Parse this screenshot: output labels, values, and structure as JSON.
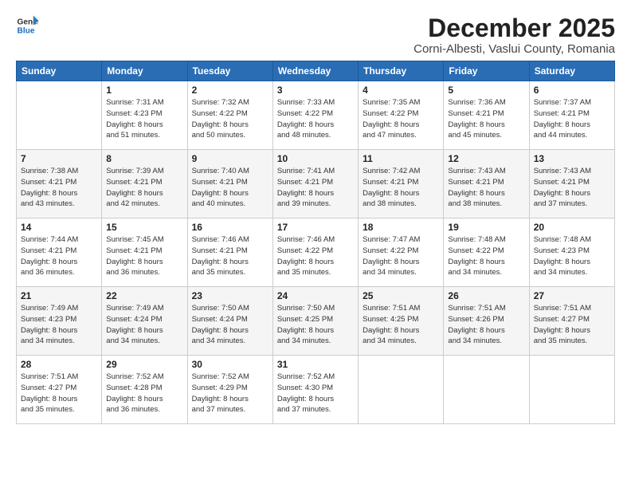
{
  "logo": {
    "line1": "General",
    "line2": "Blue"
  },
  "title": "December 2025",
  "location": "Corni-Albesti, Vaslui County, Romania",
  "weekdays": [
    "Sunday",
    "Monday",
    "Tuesday",
    "Wednesday",
    "Thursday",
    "Friday",
    "Saturday"
  ],
  "weeks": [
    [
      {
        "day": "",
        "info": ""
      },
      {
        "day": "1",
        "info": "Sunrise: 7:31 AM\nSunset: 4:23 PM\nDaylight: 8 hours\nand 51 minutes."
      },
      {
        "day": "2",
        "info": "Sunrise: 7:32 AM\nSunset: 4:22 PM\nDaylight: 8 hours\nand 50 minutes."
      },
      {
        "day": "3",
        "info": "Sunrise: 7:33 AM\nSunset: 4:22 PM\nDaylight: 8 hours\nand 48 minutes."
      },
      {
        "day": "4",
        "info": "Sunrise: 7:35 AM\nSunset: 4:22 PM\nDaylight: 8 hours\nand 47 minutes."
      },
      {
        "day": "5",
        "info": "Sunrise: 7:36 AM\nSunset: 4:21 PM\nDaylight: 8 hours\nand 45 minutes."
      },
      {
        "day": "6",
        "info": "Sunrise: 7:37 AM\nSunset: 4:21 PM\nDaylight: 8 hours\nand 44 minutes."
      }
    ],
    [
      {
        "day": "7",
        "info": "Sunrise: 7:38 AM\nSunset: 4:21 PM\nDaylight: 8 hours\nand 43 minutes."
      },
      {
        "day": "8",
        "info": "Sunrise: 7:39 AM\nSunset: 4:21 PM\nDaylight: 8 hours\nand 42 minutes."
      },
      {
        "day": "9",
        "info": "Sunrise: 7:40 AM\nSunset: 4:21 PM\nDaylight: 8 hours\nand 40 minutes."
      },
      {
        "day": "10",
        "info": "Sunrise: 7:41 AM\nSunset: 4:21 PM\nDaylight: 8 hours\nand 39 minutes."
      },
      {
        "day": "11",
        "info": "Sunrise: 7:42 AM\nSunset: 4:21 PM\nDaylight: 8 hours\nand 38 minutes."
      },
      {
        "day": "12",
        "info": "Sunrise: 7:43 AM\nSunset: 4:21 PM\nDaylight: 8 hours\nand 38 minutes."
      },
      {
        "day": "13",
        "info": "Sunrise: 7:43 AM\nSunset: 4:21 PM\nDaylight: 8 hours\nand 37 minutes."
      }
    ],
    [
      {
        "day": "14",
        "info": "Sunrise: 7:44 AM\nSunset: 4:21 PM\nDaylight: 8 hours\nand 36 minutes."
      },
      {
        "day": "15",
        "info": "Sunrise: 7:45 AM\nSunset: 4:21 PM\nDaylight: 8 hours\nand 36 minutes."
      },
      {
        "day": "16",
        "info": "Sunrise: 7:46 AM\nSunset: 4:21 PM\nDaylight: 8 hours\nand 35 minutes."
      },
      {
        "day": "17",
        "info": "Sunrise: 7:46 AM\nSunset: 4:22 PM\nDaylight: 8 hours\nand 35 minutes."
      },
      {
        "day": "18",
        "info": "Sunrise: 7:47 AM\nSunset: 4:22 PM\nDaylight: 8 hours\nand 34 minutes."
      },
      {
        "day": "19",
        "info": "Sunrise: 7:48 AM\nSunset: 4:22 PM\nDaylight: 8 hours\nand 34 minutes."
      },
      {
        "day": "20",
        "info": "Sunrise: 7:48 AM\nSunset: 4:23 PM\nDaylight: 8 hours\nand 34 minutes."
      }
    ],
    [
      {
        "day": "21",
        "info": "Sunrise: 7:49 AM\nSunset: 4:23 PM\nDaylight: 8 hours\nand 34 minutes."
      },
      {
        "day": "22",
        "info": "Sunrise: 7:49 AM\nSunset: 4:24 PM\nDaylight: 8 hours\nand 34 minutes."
      },
      {
        "day": "23",
        "info": "Sunrise: 7:50 AM\nSunset: 4:24 PM\nDaylight: 8 hours\nand 34 minutes."
      },
      {
        "day": "24",
        "info": "Sunrise: 7:50 AM\nSunset: 4:25 PM\nDaylight: 8 hours\nand 34 minutes."
      },
      {
        "day": "25",
        "info": "Sunrise: 7:51 AM\nSunset: 4:25 PM\nDaylight: 8 hours\nand 34 minutes."
      },
      {
        "day": "26",
        "info": "Sunrise: 7:51 AM\nSunset: 4:26 PM\nDaylight: 8 hours\nand 34 minutes."
      },
      {
        "day": "27",
        "info": "Sunrise: 7:51 AM\nSunset: 4:27 PM\nDaylight: 8 hours\nand 35 minutes."
      }
    ],
    [
      {
        "day": "28",
        "info": "Sunrise: 7:51 AM\nSunset: 4:27 PM\nDaylight: 8 hours\nand 35 minutes."
      },
      {
        "day": "29",
        "info": "Sunrise: 7:52 AM\nSunset: 4:28 PM\nDaylight: 8 hours\nand 36 minutes."
      },
      {
        "day": "30",
        "info": "Sunrise: 7:52 AM\nSunset: 4:29 PM\nDaylight: 8 hours\nand 37 minutes."
      },
      {
        "day": "31",
        "info": "Sunrise: 7:52 AM\nSunset: 4:30 PM\nDaylight: 8 hours\nand 37 minutes."
      },
      {
        "day": "",
        "info": ""
      },
      {
        "day": "",
        "info": ""
      },
      {
        "day": "",
        "info": ""
      }
    ]
  ]
}
